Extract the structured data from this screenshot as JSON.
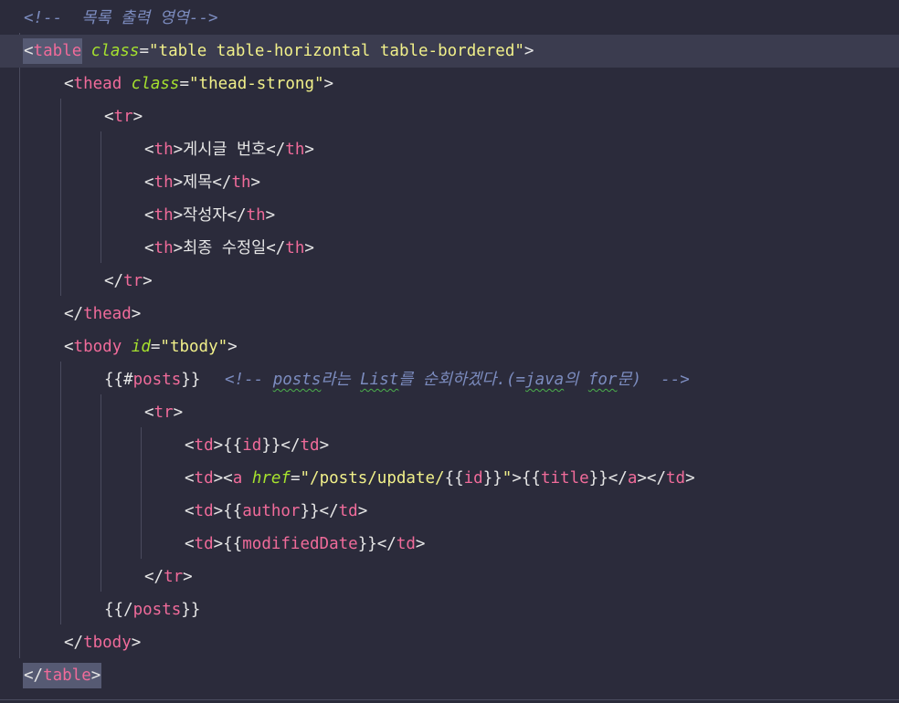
{
  "colors": {
    "background": "#2b2b3b",
    "active_line": "#3b3c4f",
    "tag": "#f06b9a",
    "attribute": "#a6e22e",
    "string": "#f1f08a",
    "comment": "#7c8cbf",
    "text": "#e6e6e6",
    "spellcheck_squiggle": "#4cb04c"
  },
  "lines": {
    "l1": {
      "open": "<!--",
      "text": "  목록 출력 영역",
      "close": "-->"
    },
    "l2": {
      "lt": "<",
      "tag": "table",
      "attr": "class",
      "eq": "=",
      "val": "\"table table-horizontal table-bordered\"",
      "gt": ">"
    },
    "l3": {
      "lt": "<",
      "tag": "thead",
      "attr": "class",
      "eq": "=",
      "val": "\"thead-strong\"",
      "gt": ">"
    },
    "l4": {
      "lt": "<",
      "tag": "tr",
      "gt": ">"
    },
    "l5": {
      "tag": "th",
      "content": "게시글 번호"
    },
    "l6": {
      "tag": "th",
      "content": "제목"
    },
    "l7": {
      "tag": "th",
      "content": "작성자"
    },
    "l8": {
      "tag": "th",
      "content": "최종 수정일"
    },
    "l9": {
      "lt": "</",
      "tag": "tr",
      "gt": ">"
    },
    "l10": {
      "lt": "</",
      "tag": "thead",
      "gt": ">"
    },
    "l11": {
      "lt": "<",
      "tag": "tbody",
      "attr": "id",
      "eq": "=",
      "val": "\"tbody\"",
      "gt": ">"
    },
    "l12": {
      "open_braces": "{{#",
      "var": "posts",
      "close_braces": "}}",
      "comment_open": "<!--",
      "w1": "posts",
      "t1": "라는 ",
      "w2": "List",
      "t2": "를 순회하겠다.(=",
      "w3": "java",
      "t3": "의 ",
      "w4": "for",
      "t4": "문) ",
      "comment_close": "-->"
    },
    "l13": {
      "lt": "<",
      "tag": "tr",
      "gt": ">"
    },
    "l14": {
      "tag": "td",
      "var": "id"
    },
    "l15": {
      "tag": "td",
      "inner_tag": "a",
      "attr": "href",
      "val_prefix": "\"/posts/update/",
      "val_var": "id",
      "val_suffix": "\"",
      "text_var": "title"
    },
    "l16": {
      "tag": "td",
      "var": "author"
    },
    "l17": {
      "tag": "td",
      "var": "modifiedDate"
    },
    "l18": {
      "lt": "</",
      "tag": "tr",
      "gt": ">"
    },
    "l19": {
      "open_braces": "{{/",
      "var": "posts",
      "close_braces": "}}"
    },
    "l20": {
      "lt": "</",
      "tag": "tbody",
      "gt": ">"
    },
    "l21": {
      "lt": "</",
      "tag": "table",
      "gt": ">"
    }
  },
  "syntax": {
    "lt": "<",
    "gt": ">",
    "close_lt": "</",
    "eq": "=",
    "open_braces": "{{",
    "close_braces": "}}"
  }
}
